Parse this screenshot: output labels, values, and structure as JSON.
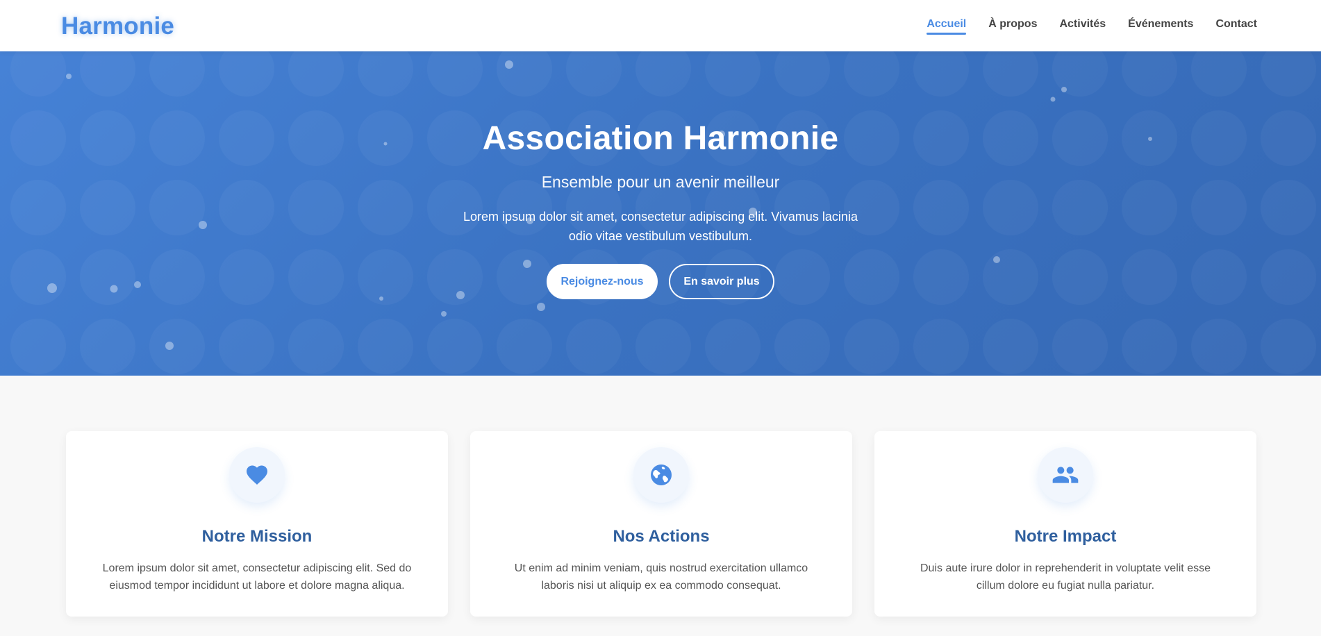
{
  "nav": {
    "logo": "Harmonie",
    "links": [
      {
        "label": "Accueil",
        "active": true
      },
      {
        "label": "À propos",
        "active": false
      },
      {
        "label": "Activités",
        "active": false
      },
      {
        "label": "Événements",
        "active": false
      },
      {
        "label": "Contact",
        "active": false
      }
    ]
  },
  "hero": {
    "title": "Association Harmonie",
    "subtitle": "Ensemble pour un avenir meilleur",
    "text": "Lorem ipsum dolor sit amet, consectetur adipiscing elit. Vivamus lacinia odio vitae vestibulum vestibulum.",
    "primary_button": "Rejoignez-nous",
    "secondary_button": "En savoir plus"
  },
  "cards": [
    {
      "icon": "heart-icon",
      "title": "Notre Mission",
      "text": "Lorem ipsum dolor sit amet, consectetur adipiscing elit. Sed do eiusmod tempor incididunt ut labore et dolore magna aliqua."
    },
    {
      "icon": "globe-icon",
      "title": "Nos Actions",
      "text": "Ut enim ad minim veniam, quis nostrud exercitation ullamco laboris nisi ut aliquip ex ea commodo consequat."
    },
    {
      "icon": "users-icon",
      "title": "Notre Impact",
      "text": "Duis aute irure dolor in reprehenderit in voluptate velit esse cillum dolore eu fugiat nulla pariatur."
    }
  ],
  "colors": {
    "accent": "#4a8be3",
    "hero_gradient_start": "#4682d6",
    "hero_gradient_end": "#3568b4",
    "card_title": "#2f5f9e",
    "page_background": "#f8f8f8"
  }
}
